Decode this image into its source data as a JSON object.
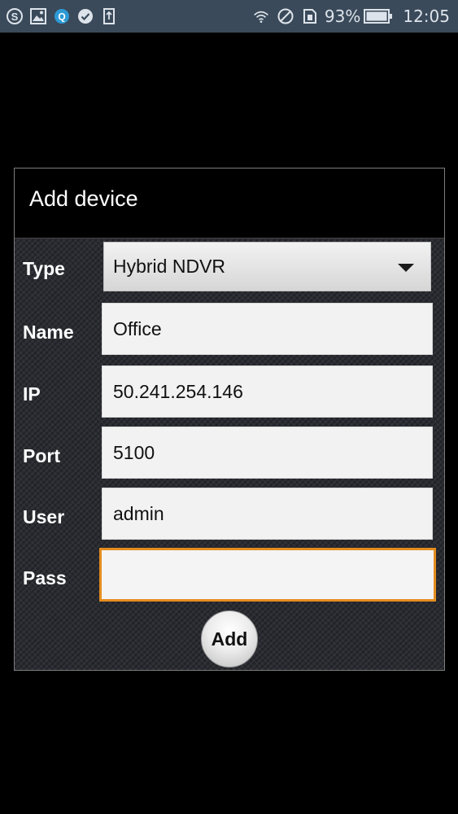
{
  "statusbar": {
    "left_icons": [
      "skype-icon",
      "image-icon",
      "app-q-icon",
      "check-badge-icon",
      "upload-icon"
    ],
    "right_icons": [
      "wifi-icon",
      "no-disturb-icon",
      "sim-icon",
      "battery-icon"
    ],
    "battery_percent": "93%",
    "time": "12:05"
  },
  "dialog": {
    "title": "Add device",
    "type_label": "Type",
    "type_value": "Hybrid NDVR",
    "name_label": "Name",
    "name_value": "Office",
    "ip_label": "IP",
    "ip_value": "50.241.254.146",
    "port_label": "Port",
    "port_value": "5100",
    "user_label": "User",
    "user_value": "admin",
    "pass_label": "Pass",
    "pass_value": "",
    "add_label": "Add"
  },
  "colors": {
    "statusbar_bg": "#3a4a5a",
    "focus_accent": "#e58d1f"
  }
}
